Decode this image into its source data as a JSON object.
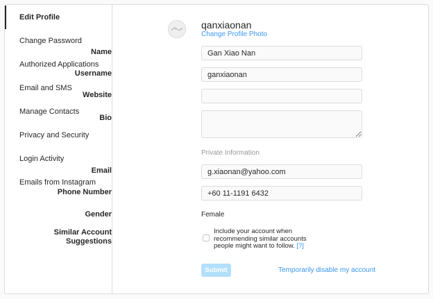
{
  "sidebar": {
    "items": [
      {
        "label": "Edit Profile",
        "active": true
      },
      {
        "label": "Change Password"
      },
      {
        "label": "Authorized Applications"
      },
      {
        "label": "Email and SMS"
      },
      {
        "label": "Manage Contacts"
      },
      {
        "label": "Privacy and Security"
      },
      {
        "label": "Login Activity"
      },
      {
        "label": "Emails from Instagram"
      }
    ]
  },
  "profile": {
    "username": "qanxiaonan",
    "change_photo_label": "Change Profile Photo",
    "avatar_icon": "avatar-icon"
  },
  "form": {
    "name": {
      "label": "Name",
      "value": "Gan Xiao Nan"
    },
    "username": {
      "label": "Username",
      "value": "ganxiaonan"
    },
    "website": {
      "label": "Website",
      "value": ""
    },
    "bio": {
      "label": "Bio",
      "value": ""
    },
    "private_info_title": "Private Information",
    "email": {
      "label": "Email",
      "value": "g.xiaonan@yahoo.com"
    },
    "phone": {
      "label": "Phone Number",
      "value": "+60 11-1191 6432"
    },
    "gender": {
      "label": "Gender",
      "value": "Female"
    },
    "similar": {
      "label_line1": "Similar Account",
      "label_line2": "Suggestions",
      "checkbox_text": "Include your account when recommending similar accounts people might want to follow.",
      "help_link": "[?]",
      "checked": false
    },
    "submit_label": "Submit",
    "disable_link": "Temporarily disable my account"
  },
  "colors": {
    "accent": "#3897f0",
    "submit_disabled": "#b2dffc",
    "border": "#dbdbdb",
    "muted": "#999999"
  }
}
